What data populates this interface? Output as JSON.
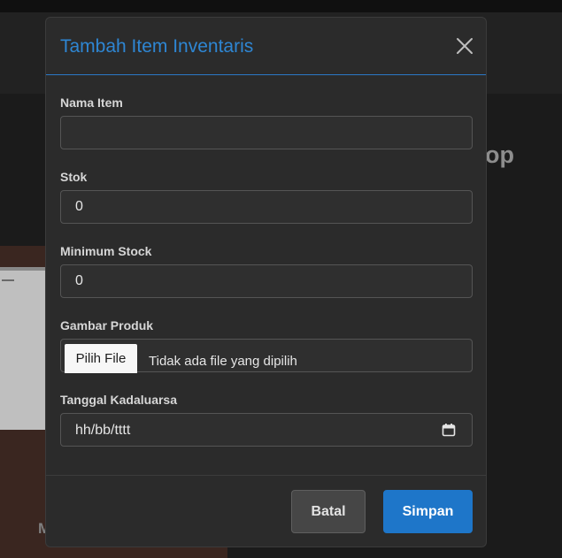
{
  "background": {
    "heading_fragment": "op",
    "card_fragment": "M"
  },
  "modal": {
    "title": "Tambah Item Inventaris",
    "close_icon": "close-icon",
    "fields": {
      "nama_item": {
        "label": "Nama Item",
        "value": "",
        "placeholder": ""
      },
      "stok": {
        "label": "Stok",
        "value": "0"
      },
      "minimum_stock": {
        "label": "Minimum Stock",
        "value": "0"
      },
      "gambar_produk": {
        "label": "Gambar Produk",
        "button": "Pilih File",
        "status": "Tidak ada file yang dipilih"
      },
      "tanggal_kadaluarsa": {
        "label": "Tanggal Kadaluarsa",
        "value": "hh/bb/tttt",
        "icon": "calendar-icon"
      }
    },
    "footer": {
      "cancel_label": "Batal",
      "save_label": "Simpan"
    }
  },
  "colors": {
    "accent": "#2e86d3",
    "primary_button": "#1e76c9",
    "modal_bg": "#2b2b2b",
    "page_bg": "#1b1b1b"
  }
}
